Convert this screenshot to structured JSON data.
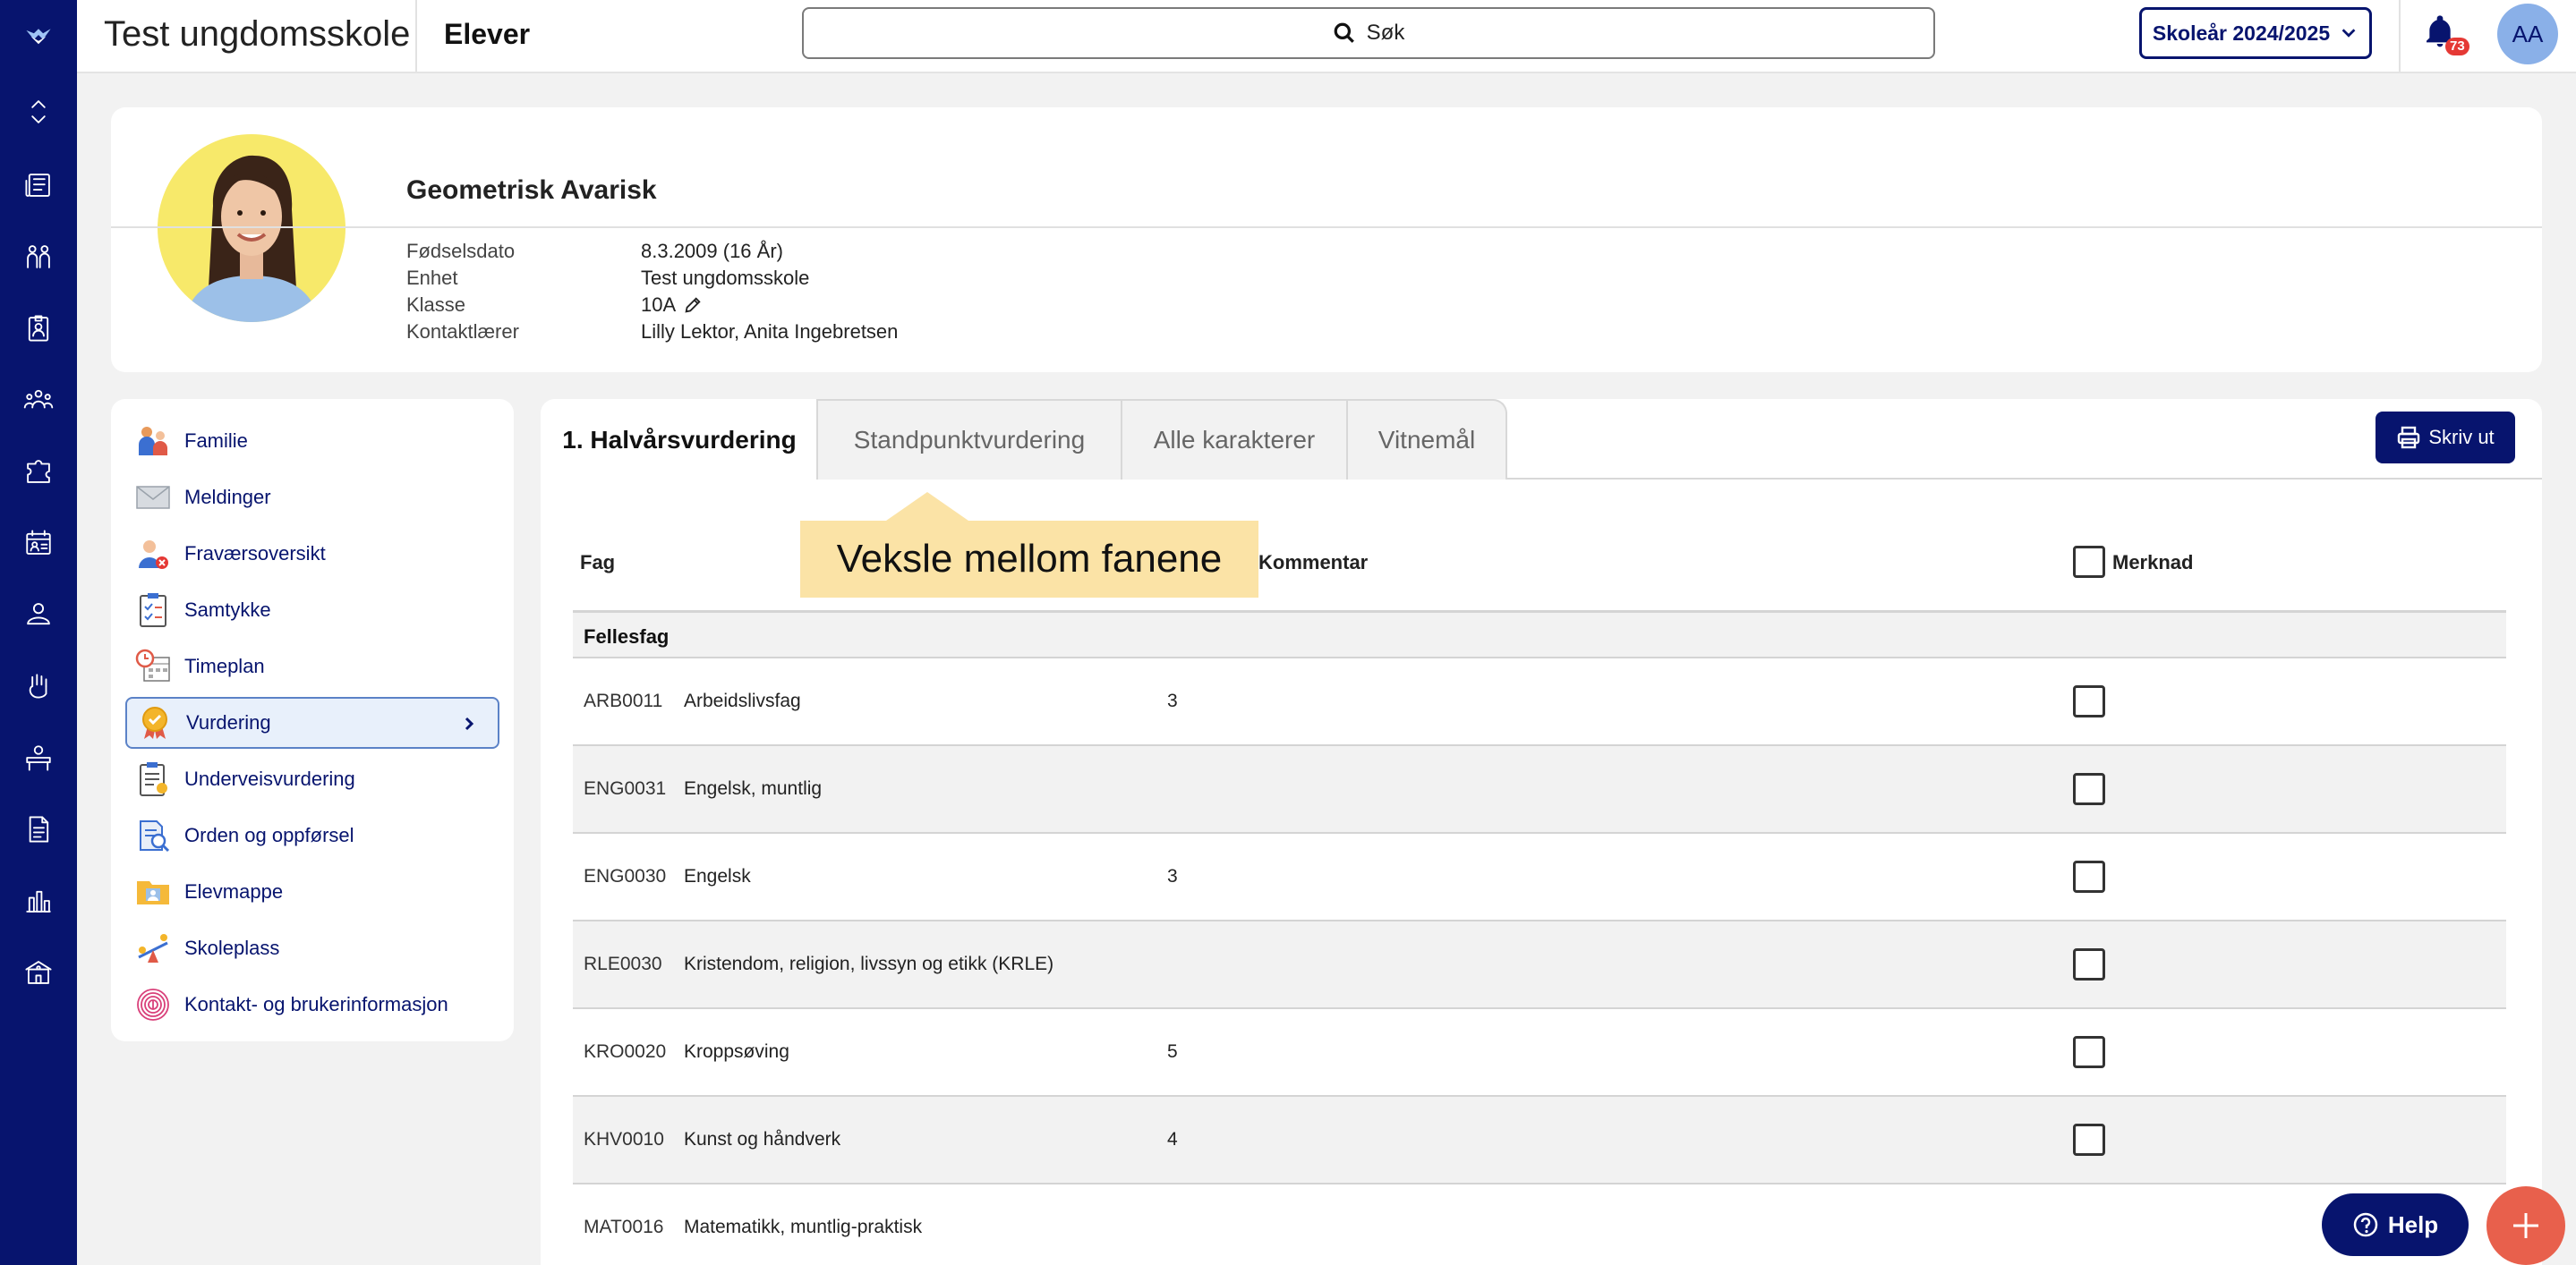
{
  "header": {
    "school": "Test ungdomsskole",
    "section": "Elever",
    "search_label": "Søk",
    "school_year": "Skoleår 2024/2025",
    "notification_count": "73",
    "user_initials": "AA"
  },
  "student": {
    "name": "Geometrisk Avarisk",
    "fields": [
      {
        "label": "Fødselsdato",
        "value": "8.3.2009 (16 År)"
      },
      {
        "label": "Enhet",
        "value": "Test ungdomsskole"
      },
      {
        "label": "Klasse",
        "value": "10A"
      },
      {
        "label": "Kontaktlærer",
        "value": "Lilly Lektor, Anita Ingebretsen"
      }
    ]
  },
  "menu": [
    {
      "label": "Familie",
      "icon": "family-icon"
    },
    {
      "label": "Meldinger",
      "icon": "envelope-icon"
    },
    {
      "label": "Fraværsoversikt",
      "icon": "absence-icon"
    },
    {
      "label": "Samtykke",
      "icon": "clipboard-icon"
    },
    {
      "label": "Timeplan",
      "icon": "calendar-clock-icon"
    },
    {
      "label": "Vurdering",
      "icon": "medal-icon",
      "active": true
    },
    {
      "label": "Underveisvurdering",
      "icon": "clipboard-badge-icon"
    },
    {
      "label": "Orden og oppførsel",
      "icon": "document-search-icon"
    },
    {
      "label": "Elevmappe",
      "icon": "folder-icon"
    },
    {
      "label": "Skoleplass",
      "icon": "seesaw-icon"
    },
    {
      "label": "Kontakt- og brukerinformasjon",
      "icon": "fingerprint-icon"
    }
  ],
  "tabs": [
    "1. Halvårsvurdering",
    "Standpunktvurdering",
    "Alle karakterer",
    "Vitnemål"
  ],
  "print_label": "Skriv ut",
  "table": {
    "headers": {
      "subject": "Fag",
      "comment": "Kommentar",
      "remark": "Merknad"
    },
    "group": "Fellesfag",
    "rows": [
      {
        "code": "ARB0011",
        "subject": "Arbeidslivsfag",
        "grade": "3"
      },
      {
        "code": "ENG0031",
        "subject": "Engelsk, muntlig",
        "grade": ""
      },
      {
        "code": "ENG0030",
        "subject": "Engelsk",
        "grade": "3"
      },
      {
        "code": "RLE0030",
        "subject": "Kristendom, religion, livssyn og etikk (KRLE)",
        "grade": ""
      },
      {
        "code": "KRO0020",
        "subject": "Kroppsøving",
        "grade": "5"
      },
      {
        "code": "KHV0010",
        "subject": "Kunst og håndverk",
        "grade": "4"
      },
      {
        "code": "MAT0016",
        "subject": "Matematikk, muntlig-praktisk",
        "grade": ""
      }
    ]
  },
  "tooltip": "Veksle mellom fanene",
  "help_label": "Help",
  "colors": {
    "navy": "#07146e",
    "accent": "#e8604c",
    "tooltip": "#fbe3a6"
  }
}
